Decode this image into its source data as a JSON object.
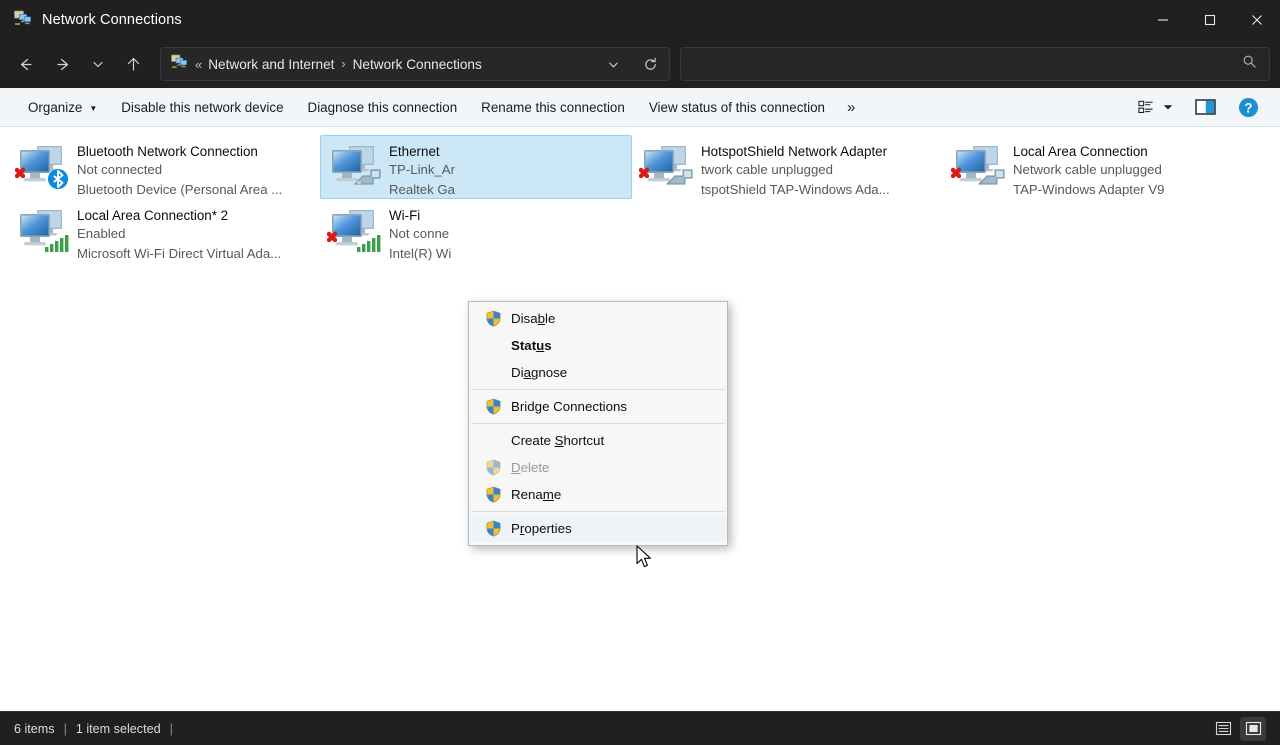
{
  "window": {
    "title": "Network Connections",
    "icon": "network-connections-icon",
    "controls": {
      "minimize": "Minimize",
      "maximize": "Maximize",
      "close": "Close"
    }
  },
  "nav": {
    "back": "Back",
    "forward": "Forward",
    "recent": "Recent locations",
    "up": "Up",
    "breadcrumb": {
      "chevrons": "«",
      "items": [
        "Network and Internet",
        "Network Connections"
      ],
      "separator": "›"
    },
    "dropdown": "Previous locations",
    "refresh": "Refresh"
  },
  "search": {
    "placeholder": "",
    "value": "",
    "icon": "search-icon"
  },
  "toolbar": {
    "organize": "Organize",
    "items": [
      "Disable this network device",
      "Diagnose this connection",
      "Rename this connection",
      "View status of this connection"
    ],
    "overflow": "»",
    "view_options": "View options",
    "preview_pane": "Preview pane",
    "help": "Help"
  },
  "connections": [
    {
      "name": "Bluetooth Network Connection",
      "status": "Not connected",
      "device": "Bluetooth Device (Personal Area ...",
      "icon": "network-adapter-icon",
      "badge": "red-x",
      "overlay": "bluetooth",
      "selected": false
    },
    {
      "name": "Ethernet",
      "status": "TP-Link_Ar",
      "device": "Realtek Ga",
      "icon": "network-adapter-icon",
      "badge": "none",
      "overlay": "ethernet-cable",
      "selected": true
    },
    {
      "name": "HotspotShield Network Adapter",
      "status": "twork cable unplugged",
      "device": "tspotShield TAP-Windows Ada...",
      "icon": "network-adapter-icon",
      "badge": "red-x",
      "overlay": "ethernet-cable",
      "selected": false
    },
    {
      "name": "Local Area Connection",
      "status": "Network cable unplugged",
      "device": "TAP-Windows Adapter V9",
      "icon": "network-adapter-icon",
      "badge": "red-x",
      "overlay": "ethernet-cable",
      "selected": false
    },
    {
      "name": "Local Area Connection* 2",
      "status": "Enabled",
      "device": "Microsoft Wi-Fi Direct Virtual Ada...",
      "icon": "network-adapter-icon",
      "badge": "none",
      "overlay": "wifi-bars",
      "selected": false
    },
    {
      "name": "Wi-Fi",
      "status": "Not conne",
      "device": "Intel(R) Wi",
      "icon": "network-adapter-icon",
      "badge": "red-x",
      "overlay": "wifi-bars",
      "selected": false
    }
  ],
  "context_menu": {
    "items": [
      {
        "label": "Disable",
        "accel": "b",
        "shield": true,
        "disabled": false,
        "bold": false,
        "hovered": false
      },
      {
        "label": "Status",
        "accel": "u",
        "shield": false,
        "disabled": false,
        "bold": true,
        "hovered": false
      },
      {
        "label": "Diagnose",
        "accel": "a",
        "shield": false,
        "disabled": false,
        "bold": false,
        "hovered": false
      },
      {
        "separator": true
      },
      {
        "label": "Bridge Connections",
        "accel": "g",
        "shield": true,
        "disabled": false,
        "bold": false,
        "hovered": false
      },
      {
        "separator": true
      },
      {
        "label": "Create Shortcut",
        "accel": "S",
        "shield": false,
        "disabled": false,
        "bold": false,
        "hovered": false
      },
      {
        "label": "Delete",
        "accel": "D",
        "shield": true,
        "disabled": true,
        "bold": false,
        "hovered": false
      },
      {
        "label": "Rename",
        "accel": "m",
        "shield": true,
        "disabled": false,
        "bold": false,
        "hovered": false
      },
      {
        "separator": true
      },
      {
        "label": "Properties",
        "accel": "r",
        "shield": true,
        "disabled": false,
        "bold": false,
        "hovered": true
      }
    ]
  },
  "statusbar": {
    "item_count": "6 items",
    "selection": "1 item selected",
    "separator": "|",
    "views": {
      "details": "Details view",
      "large_icons": "Large icons view",
      "active": "large_icons"
    }
  },
  "colors": {
    "titlebar_bg": "#202020",
    "toolbar_bg": "#f3f6f9",
    "content_bg": "#ffffff",
    "selection_bg": "#cce8f7",
    "selection_border": "#99d1f2",
    "accent_blue": "#0f7cc4",
    "help_blue": "#1a8fd1",
    "close_hover": "#c42b1c",
    "menu_bg": "#f7f7f7"
  }
}
